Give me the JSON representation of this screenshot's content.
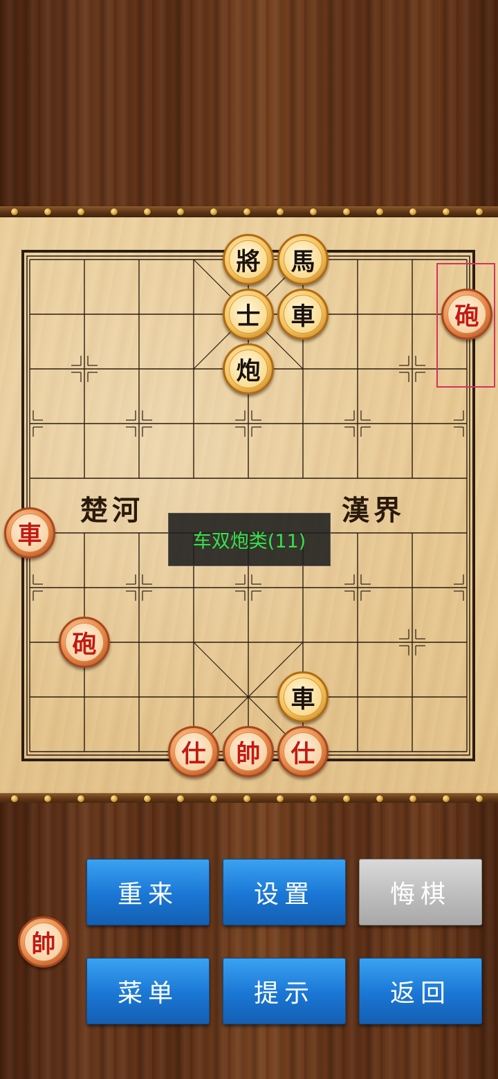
{
  "board": {
    "river_left": "楚河",
    "river_right": "漢界"
  },
  "pieces": [
    {
      "char": "將",
      "side": "black",
      "col": 4,
      "row": 0
    },
    {
      "char": "馬",
      "side": "black",
      "col": 5,
      "row": 0
    },
    {
      "char": "士",
      "side": "black",
      "col": 4,
      "row": 1
    },
    {
      "char": "車",
      "side": "black",
      "col": 5,
      "row": 1
    },
    {
      "char": "炮",
      "side": "black",
      "col": 4,
      "row": 2
    },
    {
      "char": "砲",
      "side": "red",
      "col": 8,
      "row": 1
    },
    {
      "char": "車",
      "side": "red",
      "col": 0,
      "row": 5
    },
    {
      "char": "砲",
      "side": "red",
      "col": 1,
      "row": 7
    },
    {
      "char": "車",
      "side": "black",
      "col": 5,
      "row": 8
    },
    {
      "char": "仕",
      "side": "red",
      "col": 3,
      "row": 9
    },
    {
      "char": "帥",
      "side": "red",
      "col": 4,
      "row": 9
    },
    {
      "char": "仕",
      "side": "red",
      "col": 5,
      "row": 9
    }
  ],
  "toast": {
    "text": "车双炮类(11)"
  },
  "turn_indicator": {
    "char": "帥",
    "side": "red"
  },
  "buttons": {
    "restart": "重来",
    "settings": "设置",
    "undo": "悔棋",
    "menu": "菜单",
    "hint": "提示",
    "back": "返回"
  },
  "colors": {
    "toast_text": "#34e24a",
    "selection_border": "#d2335e",
    "button_blue": "#1a76d4",
    "button_disabled": "#bdbdbd"
  }
}
